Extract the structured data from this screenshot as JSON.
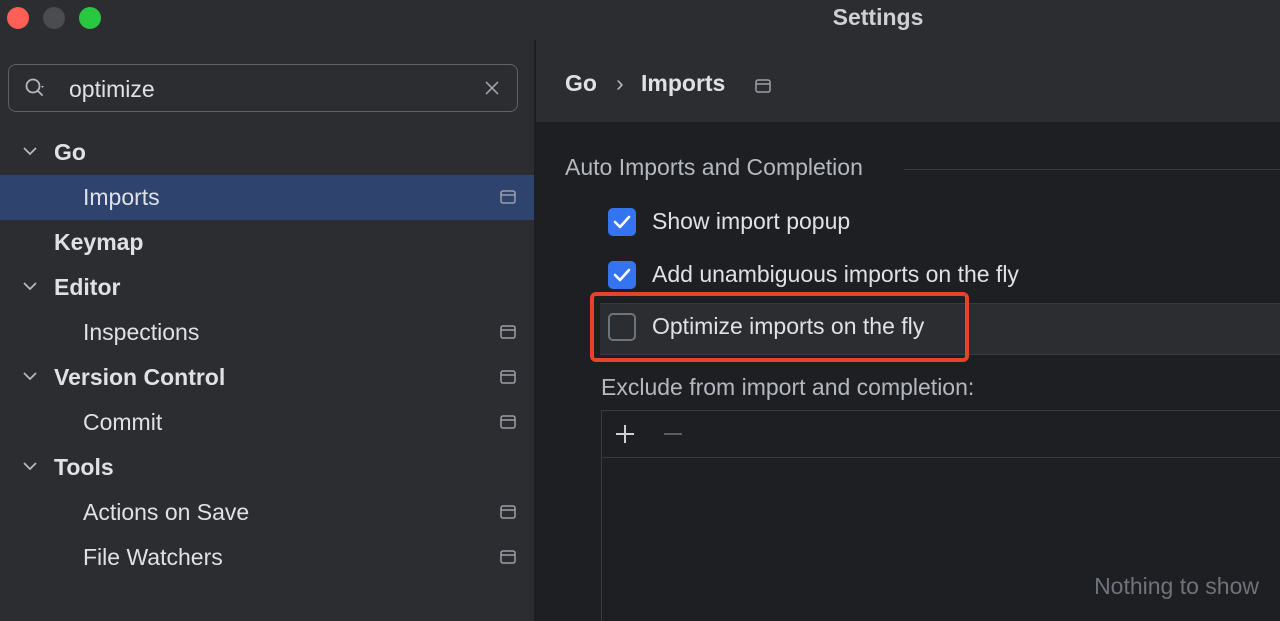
{
  "window": {
    "title": "Settings"
  },
  "search": {
    "value": "optimize"
  },
  "sidebar": {
    "items": [
      {
        "label": "Go"
      },
      {
        "label": "Imports"
      },
      {
        "label": "Keymap"
      },
      {
        "label": "Editor"
      },
      {
        "label": "Inspections"
      },
      {
        "label": "Version Control"
      },
      {
        "label": "Commit"
      },
      {
        "label": "Tools"
      },
      {
        "label": "Actions on Save"
      },
      {
        "label": "File Watchers"
      }
    ]
  },
  "main": {
    "breadcrumb": {
      "parent": "Go",
      "separator": "›",
      "current": "Imports"
    },
    "section_title": "Auto Imports and Completion",
    "options": [
      {
        "label": "Show import popup",
        "checked": true
      },
      {
        "label": "Add unambiguous imports on the fly",
        "checked": true
      },
      {
        "label": "Optimize imports on the fly",
        "checked": false
      }
    ],
    "exclude_label": "Exclude from import and completion:",
    "empty_text": "Nothing to show"
  },
  "colors": {
    "accent": "#3574f0",
    "selection": "#2e436e",
    "highlight": "#e8422a"
  }
}
